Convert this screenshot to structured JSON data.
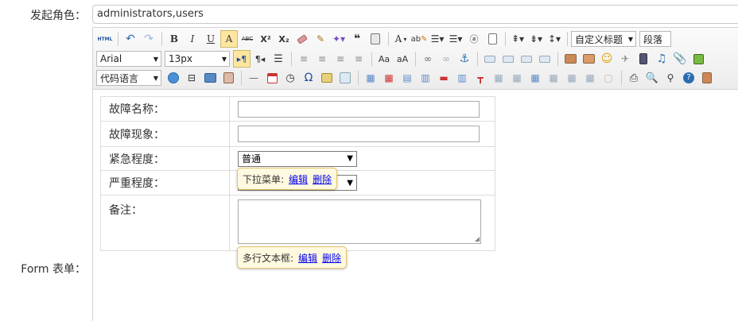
{
  "labels": {
    "role": "发起角色：",
    "form": "Form 表单："
  },
  "role_input": {
    "value": "administrators,users"
  },
  "toolbar": {
    "html_label": "HTML",
    "font_family": "Arial",
    "font_size": "13px",
    "font_family_cn": "代码语言",
    "custom_title": "自定义标题",
    "paragraph": "段落",
    "bold": "B",
    "italic": "I",
    "underline": "U",
    "font_border": "A",
    "strike": "ABC",
    "superscript": "X²",
    "subscript": "X₂",
    "quote": "❝",
    "forecolor": "A",
    "omega": "Ω",
    "colors": {
      "accent": "#ffe69f",
      "border": "#c9b96a"
    }
  },
  "form": {
    "rows": [
      {
        "label": "故障名称："
      },
      {
        "label": "故障现象："
      },
      {
        "label": "紧急程度：",
        "select_value": "普通"
      },
      {
        "label": "严重程度："
      },
      {
        "label": "备注："
      }
    ]
  },
  "popups": {
    "dropdown": {
      "prefix": "下拉菜单:",
      "edit": "编辑",
      "delete": "删除"
    },
    "textarea": {
      "prefix": "多行文本框:",
      "edit": "编辑",
      "delete": "删除"
    }
  }
}
